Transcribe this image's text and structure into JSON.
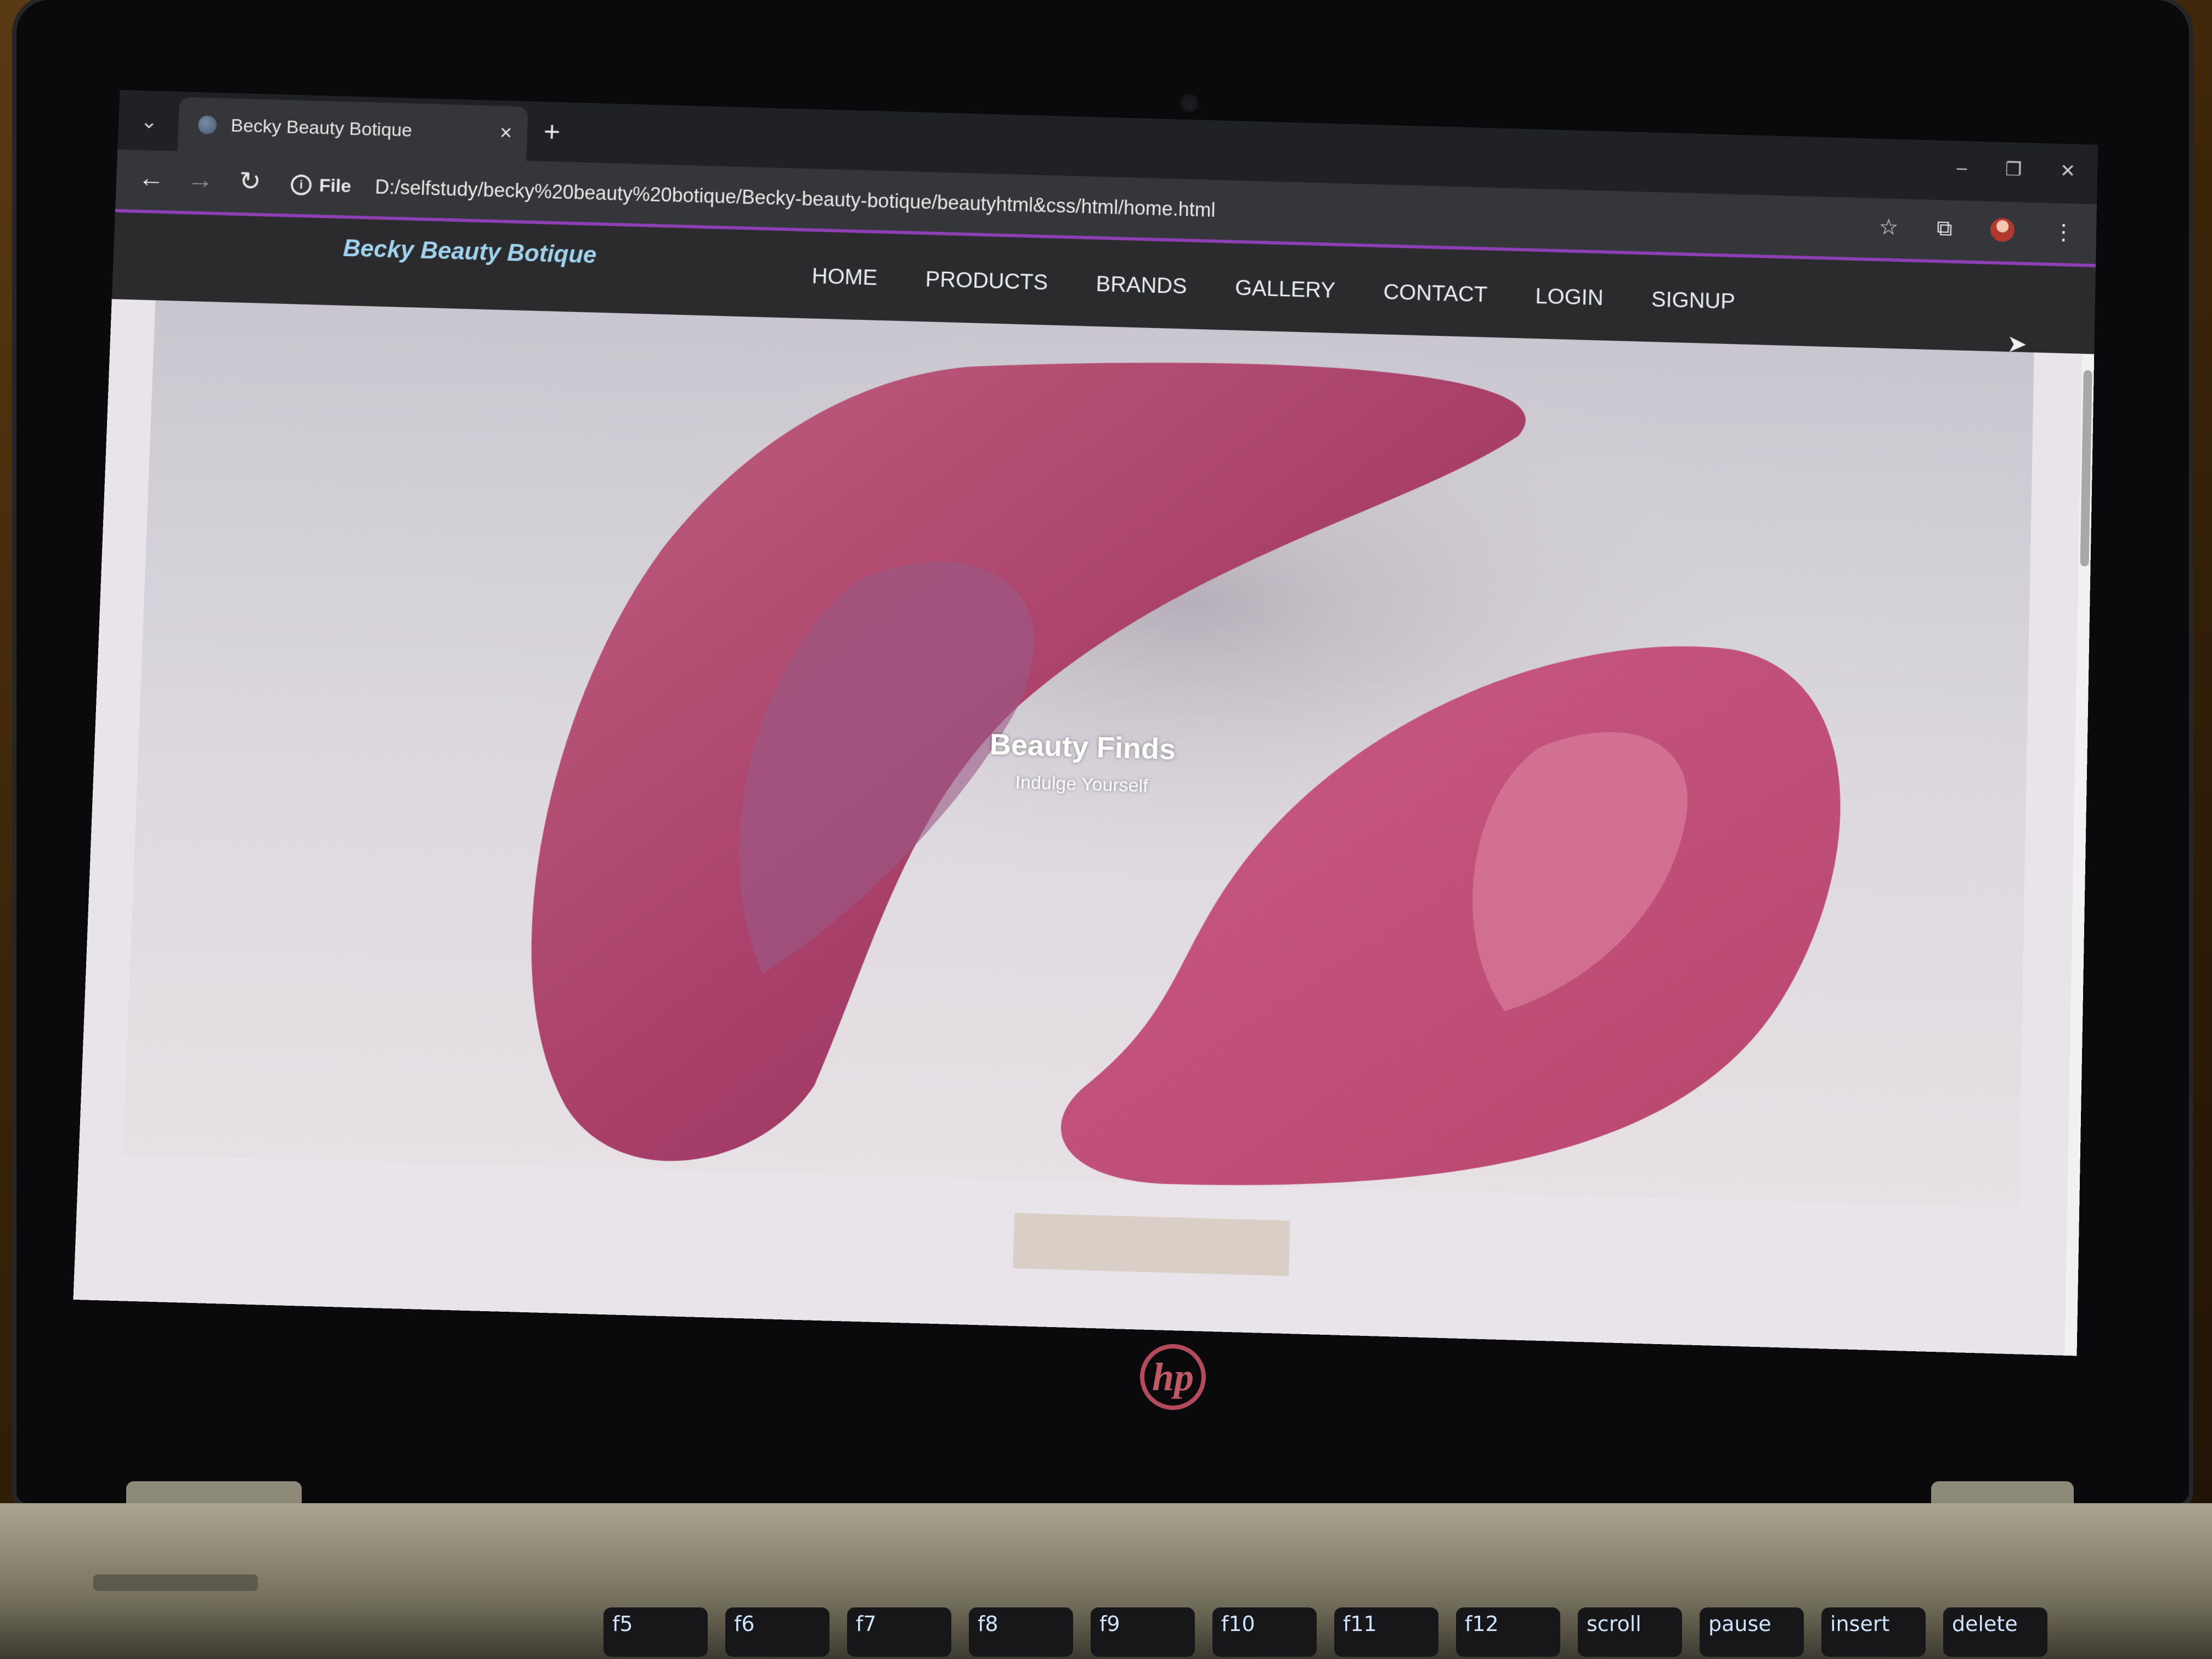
{
  "browser": {
    "tab_title": "Becky Beauty Botique",
    "tab_close": "×",
    "new_tab": "+",
    "tab_list": "⌄",
    "window": {
      "minimize": "–",
      "restore": "❐",
      "close": "✕"
    },
    "nav": {
      "back": "←",
      "forward": "→",
      "reload": "↻"
    },
    "omnibox": {
      "info": "i",
      "scheme_label": "File",
      "url": "D:/selfstudy/becky%20beauty%20botique/Becky-beauty-botique/beautyhtml&css/html/home.html"
    },
    "toolbar_icons": {
      "bookmark": "☆",
      "extensions": "⧉",
      "menu": "⋮"
    }
  },
  "site": {
    "logo": "Becky Beauty Botique",
    "menu": [
      "HOME",
      "PRODUCTS",
      "BRANDS",
      "GALLERY",
      "CONTACT",
      "LOGIN",
      "SIGNUP"
    ],
    "hero": {
      "title": "Beauty Finds",
      "subtitle": "Indulge Yourself"
    }
  },
  "device": {
    "brand_logo": "hp",
    "function_keys": [
      "f5",
      "f6",
      "f7",
      "f8",
      "f9",
      "f10",
      "f11",
      "f12",
      "scroll",
      "pause",
      "insert",
      "delete"
    ]
  },
  "colors": {
    "accent": "#8e3fb4",
    "logo_text": "#9fd3ee",
    "nav_bg": "#2b2b2e",
    "lipstick": "#b84a6e"
  }
}
